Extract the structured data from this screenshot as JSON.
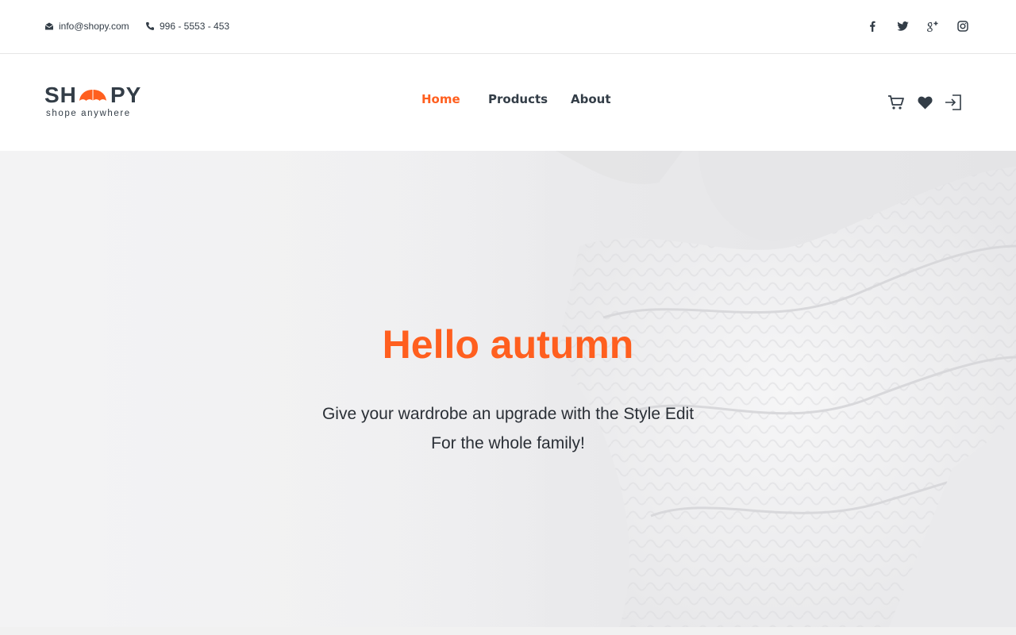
{
  "topbar": {
    "email": "info@shopy.com",
    "phone": "996 - 5553 - 453",
    "social": [
      "facebook-icon",
      "twitter-icon",
      "google-plus-icon",
      "instagram-icon"
    ]
  },
  "brand": {
    "left": "SH",
    "right": "PY",
    "tagline": "shope anywhere",
    "accent": "#ff5f1f",
    "text_color": "#333d47"
  },
  "nav": {
    "home": "Home",
    "products": "Products",
    "about": "About",
    "active": "Home"
  },
  "header_icons": [
    "cart-icon",
    "heart-icon",
    "login-icon"
  ],
  "hero": {
    "title": "Hello autumn",
    "line1": "Give your wardrobe an upgrade with the Style Edit",
    "line2": "For the whole family!"
  }
}
